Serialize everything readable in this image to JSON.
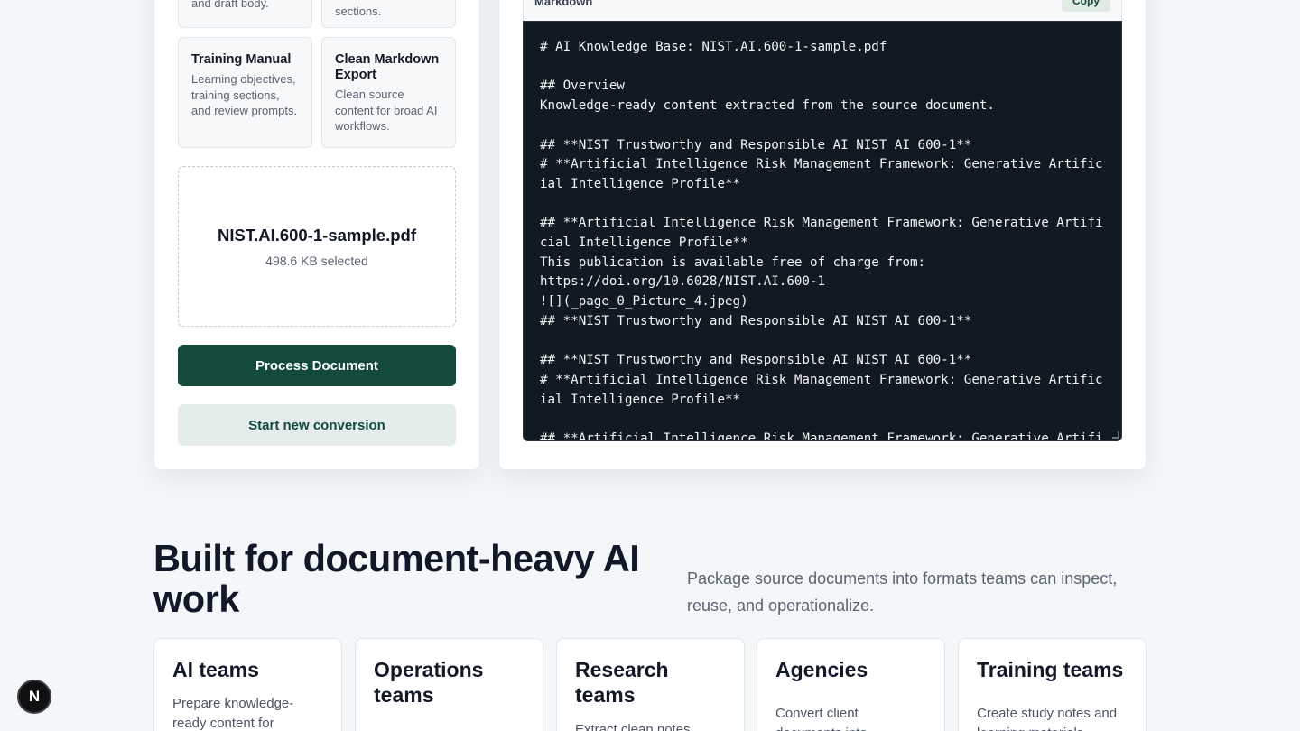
{
  "formats": [
    {
      "title": "",
      "desc": "and draft body."
    },
    {
      "title": "",
      "desc": "sections."
    },
    {
      "title": "Training Manual",
      "desc": "Learning objectives, training sections, and review prompts."
    },
    {
      "title": "Clean Markdown Export",
      "desc": "Clean source content for broad AI workflows."
    }
  ],
  "upload": {
    "file_name": "NIST.AI.600-1-sample.pdf",
    "file_size": "498.6 KB selected"
  },
  "actions": {
    "process_label": "Process Document",
    "new_label": "Start new conversion"
  },
  "preview": {
    "label": "Markdown",
    "copy_label": "Copy",
    "content": "# AI Knowledge Base: NIST.AI.600-1-sample.pdf\n\n## Overview\nKnowledge-ready content extracted from the source document.\n\n## **NIST Trustworthy and Responsible AI NIST AI 600-1**\n# **Artificial Intelligence Risk Management Framework: Generative Artificial Intelligence Profile**\n\n## **Artificial Intelligence Risk Management Framework: Generative Artificial Intelligence Profile**\nThis publication is available free of charge from:\nhttps://doi.org/10.6028/NIST.AI.600-1\n![](_page_0_Picture_4.jpeg)\n## **NIST Trustworthy and Responsible AI NIST AI 600-1**\n\n## **NIST Trustworthy and Responsible AI NIST AI 600-1**\n# **Artificial Intelligence Risk Management Framework: Generative Artificial Intelligence Profile**\n\n## **Artificial Intelligence Risk Management Framework: Generative Artificial Intelligence Profile**"
  },
  "section": {
    "heading": "Built for document-heavy AI work",
    "subtitle": "Package source documents into formats teams can inspect, reuse, and operationalize."
  },
  "teams": [
    {
      "title": "AI teams",
      "desc": "Prepare knowledge-ready content for"
    },
    {
      "title": "Operations teams",
      "desc": ""
    },
    {
      "title": "Research teams",
      "desc": "Extract clean notes,"
    },
    {
      "title": "Agencies",
      "desc": "Convert client documents into deliverables"
    },
    {
      "title": "Training teams",
      "desc": "Create study notes and learning materials"
    }
  ],
  "badge": {
    "letter": "N"
  },
  "colors": {
    "primary": "#134a3c",
    "code_bg": "#111a22",
    "page_bg": "#f4f7f9"
  }
}
